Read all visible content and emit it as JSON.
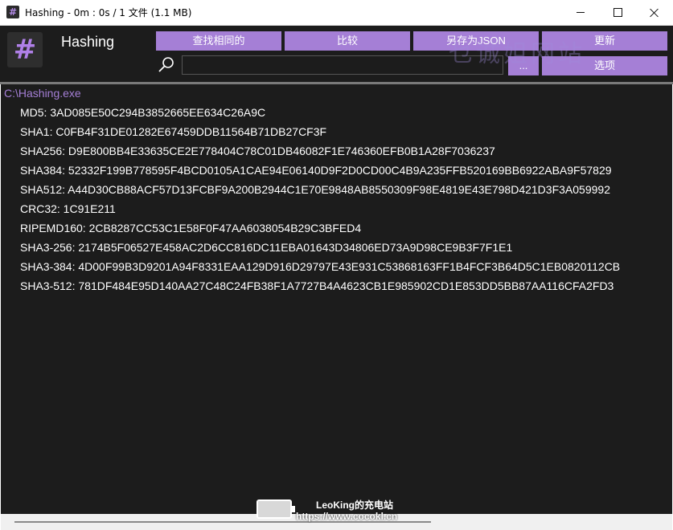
{
  "window": {
    "title": "Hashing - 0m : 0s / 1 文件 (1.1 MB)",
    "icon_glyph": "#"
  },
  "header": {
    "logo_glyph": "#",
    "app_name": "Hashing",
    "buttons": {
      "find_same": "查找相同的",
      "compare": "比较",
      "save_json": "另存为JSON",
      "update": "更新",
      "browse": "...",
      "options": "选项"
    },
    "search": {
      "value": "",
      "placeholder": ""
    },
    "watermark": "乜诚姐网站"
  },
  "results": {
    "file_path": "C:\\Hashing.exe",
    "hashes": [
      "MD5: 3AD085E50C294B3852665EE634C26A9C",
      "SHA1: C0FB4F31DE01282E67459DDB11564B71DB27CF3F",
      "SHA256: D9E800BB4E33635CE2E778404C78C01DB46082F1E746360EFB0B1A28F7036237",
      "SHA384: 52332F199B778595F4BCD0105A1CAE94E06140D9F2D0CD00C4B9A235FFB520169BB6922ABA9F57829",
      "SHA512: A44D30CB88ACF57D13FCBF9A200B2944C1E70E9848AB8550309F98E4819E43E798D421D3F3A059992",
      "CRC32: 1C91E211",
      "RIPEMD160: 2CB8287CC53C1E58F0F47AA6038054B29C3BFED4",
      "SHA3-256: 2174B5F06527E458AC2D6CC816DC11EBA01643D34806ED73A9D98CE9B3F7F1E1",
      "SHA3-384: 4D00F99B3D9201A94F8331EAA129D916D29797E43E931C53868163FF1B4FCF3B64D5C1EB0820112CB",
      "SHA3-512: 781DF484E95D140AA27C48C24FB38F1A7727B4A4623CB1E985902CD1E853DD5BB87AA116CFA2FD3"
    ]
  },
  "overlay_watermark": {
    "line1": "LeoKing的充电站",
    "line2": "https://www.cocokl.cn"
  },
  "colors": {
    "accent": "#a57fd6",
    "background": "#1c1c1c",
    "text": "#ffffff"
  },
  "icons": {
    "search": "search-icon",
    "minimize": "minimize-icon",
    "maximize": "maximize-icon",
    "close": "close-icon"
  }
}
